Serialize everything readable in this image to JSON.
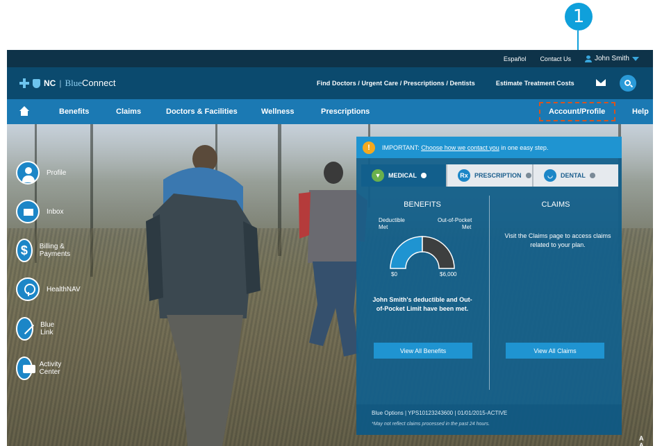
{
  "callout": {
    "number": "1"
  },
  "utility": {
    "espanol": "Español",
    "contact": "Contact Us",
    "user_name": "John Smith"
  },
  "brand": {
    "nc": "NC",
    "sep": "|",
    "blue": "Blue",
    "connect": "Connect",
    "find_link": "Find Doctors / Urgent Care / Prescriptions / Dentists",
    "estimate_link": "Estimate Treatment Costs"
  },
  "nav": {
    "benefits": "Benefits",
    "claims": "Claims",
    "doctors": "Doctors & Facilities",
    "wellness": "Wellness",
    "prescriptions": "Prescriptions",
    "account": "Account/Profile",
    "help": "Help"
  },
  "quick_links": [
    "Profile",
    "Inbox",
    "Billing & Payments",
    "HealthNAV",
    "Blue Link",
    "Activity Center"
  ],
  "alert": {
    "icon": "!",
    "prefix": "IMPORTANT: ",
    "link": "Choose how we contact you",
    "suffix": " in one easy step."
  },
  "tabs": {
    "medical": "MEDICAL",
    "prescription": "PRESCRIPTION",
    "dental": "DENTAL",
    "rx_icon": "Rx"
  },
  "benefits": {
    "title": "BENEFITS",
    "deductible_label_1": "Deductible",
    "deductible_label_2": "Met",
    "oop_label_1": "Out-of-Pocket",
    "oop_label_2": "Met",
    "min_value": "$0",
    "max_value": "$6,000",
    "status_text": "John Smith's deductible and Out-of-Pocket Limit have been met.",
    "button": "View All Benefits",
    "deductible_fill": 1.0,
    "oop_fill": 1.0
  },
  "claims": {
    "title": "CLAIMS",
    "text": "Visit the Claims page to access claims related to your plan.",
    "button": "View All Claims"
  },
  "plan": {
    "info": "Blue Options | YPS10123243600 | 01/01/2015-ACTIVE",
    "note": "*May not reflect claims processed in the past 24 hours."
  },
  "text_size": "A A",
  "colors": {
    "nav_blue": "#1b79b3",
    "dark_navy": "#0e3349",
    "accent": "#1f94d1",
    "callout": "#0fa0db",
    "highlight_box": "#d9541e",
    "alert_warn": "#f4a91f"
  }
}
